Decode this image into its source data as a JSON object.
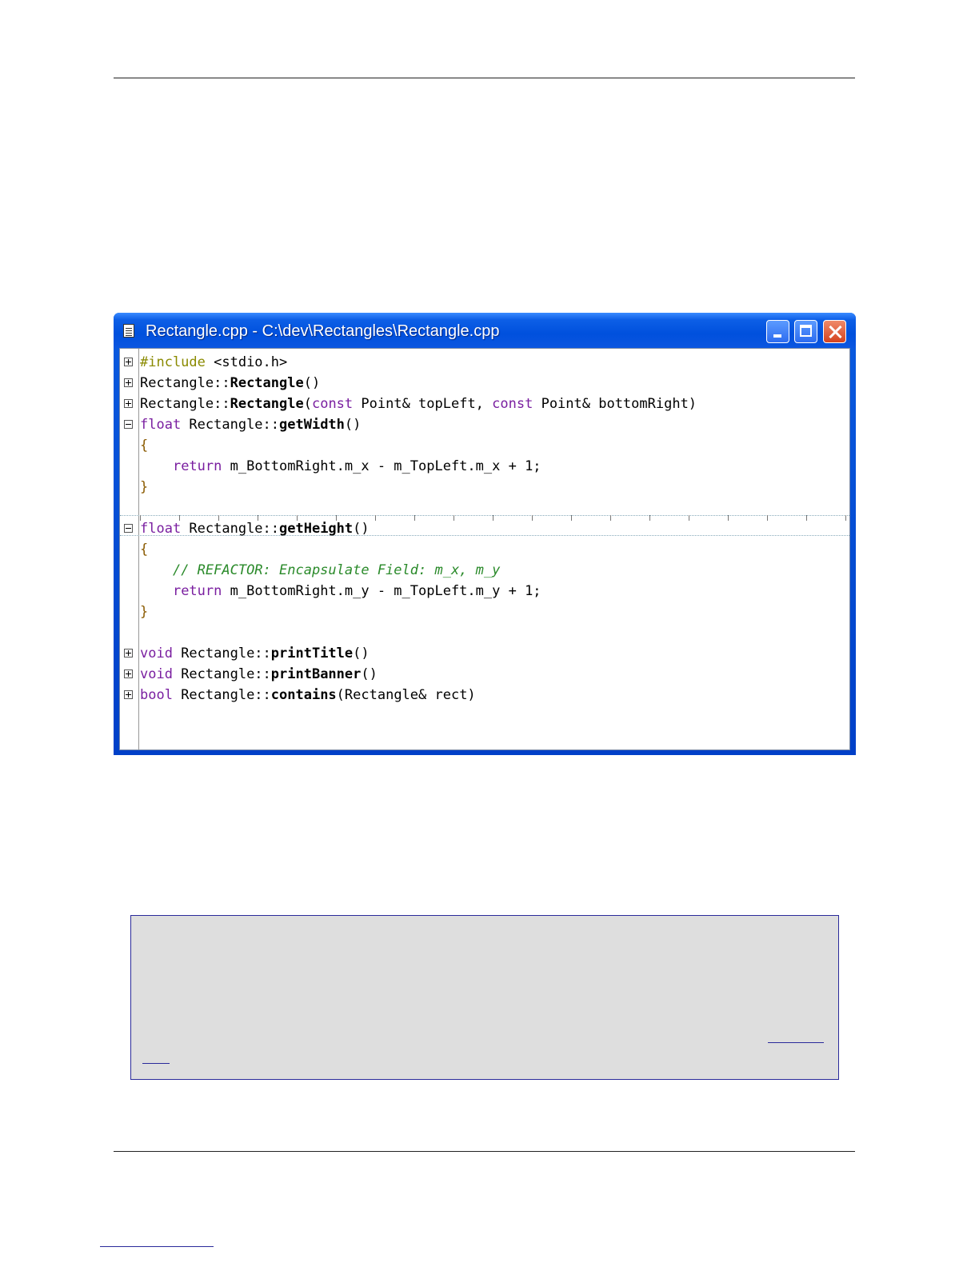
{
  "window": {
    "title": "Rectangle.cpp - C:\\dev\\Rectangles\\Rectangle.cpp"
  },
  "code": {
    "lines": [
      [
        {
          "t": "#include",
          "c": "pp"
        },
        {
          "t": " <stdio.h>",
          "c": "nm"
        }
      ],
      [
        {
          "t": "Rectangle::",
          "c": "nm"
        },
        {
          "t": "Rectangle",
          "c": "fn"
        },
        {
          "t": "()",
          "c": "nm"
        }
      ],
      [
        {
          "t": "Rectangle::",
          "c": "nm"
        },
        {
          "t": "Rectangle",
          "c": "fn"
        },
        {
          "t": "(",
          "c": "nm"
        },
        {
          "t": "const",
          "c": "kw"
        },
        {
          "t": " Point& topLeft, ",
          "c": "nm"
        },
        {
          "t": "const",
          "c": "kw"
        },
        {
          "t": " Point& bottomRight)",
          "c": "nm"
        }
      ],
      [
        {
          "t": "float",
          "c": "kw"
        },
        {
          "t": " Rectangle::",
          "c": "nm"
        },
        {
          "t": "getWidth",
          "c": "fn"
        },
        {
          "t": "()",
          "c": "nm"
        }
      ],
      [
        {
          "t": "{",
          "c": "br"
        }
      ],
      [
        {
          "t": "    ",
          "c": "nm"
        },
        {
          "t": "return",
          "c": "kw"
        },
        {
          "t": " m_BottomRight.m_x - m_TopLeft.m_x + 1;",
          "c": "nm"
        }
      ],
      [
        {
          "t": "}",
          "c": "br"
        }
      ],
      [],
      [
        {
          "t": "float",
          "c": "kw"
        },
        {
          "t": " Rectangle::",
          "c": "nm"
        },
        {
          "t": "getHeight",
          "c": "fn"
        },
        {
          "t": "()",
          "c": "nm"
        }
      ],
      [
        {
          "t": "{",
          "c": "br"
        }
      ],
      [
        {
          "t": "    ",
          "c": "nm"
        },
        {
          "t": "// REFACTOR: Encapsulate Field: m_x, m_y",
          "c": "cm"
        }
      ],
      [
        {
          "t": "    ",
          "c": "nm"
        },
        {
          "t": "return",
          "c": "kw"
        },
        {
          "t": " m_BottomRight.m_y - m_TopLeft.m_y + 1;",
          "c": "nm"
        }
      ],
      [
        {
          "t": "}",
          "c": "br"
        }
      ],
      [],
      [
        {
          "t": "void",
          "c": "kw"
        },
        {
          "t": " Rectangle::",
          "c": "nm"
        },
        {
          "t": "printTitle",
          "c": "fn"
        },
        {
          "t": "()",
          "c": "nm"
        }
      ],
      [
        {
          "t": "void",
          "c": "kw"
        },
        {
          "t": " Rectangle::",
          "c": "nm"
        },
        {
          "t": "printBanner",
          "c": "fn"
        },
        {
          "t": "()",
          "c": "nm"
        }
      ],
      [
        {
          "t": "bool",
          "c": "kw"
        },
        {
          "t": " Rectangle::",
          "c": "nm"
        },
        {
          "t": "contains",
          "c": "fn"
        },
        {
          "t": "(Rectangle& rect)",
          "c": "nm"
        }
      ]
    ],
    "folds": [
      {
        "line": 0,
        "state": "collapsed"
      },
      {
        "line": 1,
        "state": "collapsed"
      },
      {
        "line": 2,
        "state": "collapsed"
      },
      {
        "line": 3,
        "state": "expanded"
      },
      {
        "line": 8,
        "state": "expanded"
      },
      {
        "line": 14,
        "state": "collapsed"
      },
      {
        "line": 15,
        "state": "collapsed"
      },
      {
        "line": 16,
        "state": "collapsed"
      }
    ]
  },
  "colors": {
    "keyword": "#7a1fa0",
    "preprocessor": "#8a8a00",
    "comment": "#2a8a2a",
    "titlebar": "#0050dd"
  }
}
